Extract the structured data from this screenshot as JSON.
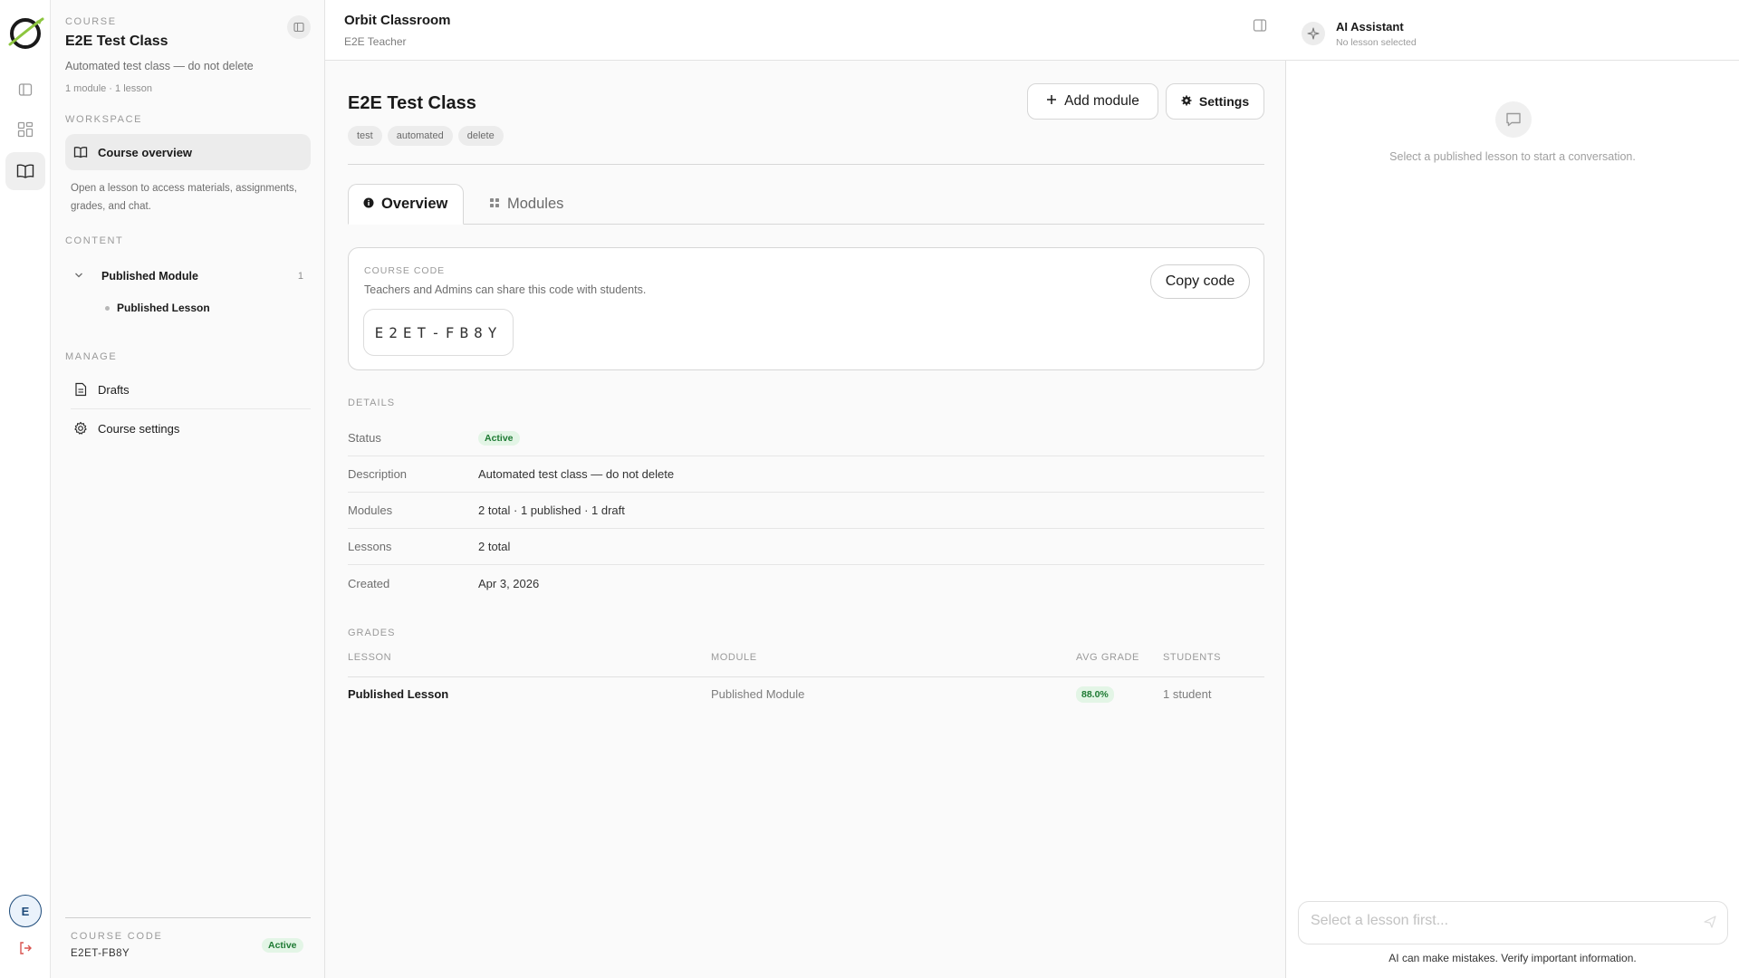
{
  "sidebar": {
    "course_label": "COURSE",
    "course_title": "E2E Test Class",
    "course_description": "Automated test class — do not delete",
    "course_meta": "1 module · 1 lesson",
    "workspace_label": "WORKSPACE",
    "course_overview": "Course overview",
    "help_text": "Open a lesson to access materials, assignments, grades, and chat.",
    "content_label": "CONTENT",
    "module_name": "Published Module",
    "module_count": "1",
    "lesson_name": "Published Lesson",
    "manage_label": "MANAGE",
    "drafts": "Drafts",
    "course_settings": "Course settings",
    "footer_label": "COURSE CODE",
    "footer_code": "E2ET-FB8Y",
    "footer_status": "Active"
  },
  "rail": {
    "avatar_initial": "E"
  },
  "topbar": {
    "app_name": "Orbit Classroom",
    "role": "E2E Teacher"
  },
  "page": {
    "title": "E2E Test Class",
    "tags": [
      "test",
      "automated",
      "delete"
    ],
    "add_module": "Add module",
    "settings": "Settings",
    "tabs": [
      "Overview",
      "Modules"
    ]
  },
  "code_card": {
    "label": "COURSE CODE",
    "subtitle": "Teachers and Admins can share this code with students.",
    "code": "E2ET-FB8Y",
    "copy_button": "Copy code"
  },
  "details": {
    "label": "DETAILS",
    "rows": [
      {
        "key": "Status",
        "value": "Active"
      },
      {
        "key": "Description",
        "value": "Automated test class — do not delete"
      },
      {
        "key": "Modules",
        "value": "2 total · 1 published · 1 draft"
      },
      {
        "key": "Lessons",
        "value": "2 total"
      },
      {
        "key": "Created",
        "value": "Apr 3, 2026"
      }
    ]
  },
  "grades": {
    "label": "GRADES",
    "columns": [
      "LESSON",
      "MODULE",
      "AVG GRADE",
      "STUDENTS"
    ],
    "rows": [
      {
        "lesson": "Published Lesson",
        "module": "Published Module",
        "avg_grade": "88.0%",
        "students": "1 student"
      }
    ]
  },
  "ai_panel": {
    "title": "AI Assistant",
    "subtitle": "No lesson selected",
    "empty_text": "Select a published lesson to start a conversation.",
    "input_placeholder": "Select a lesson first...",
    "disclaimer": "AI can make mistakes. Verify important information."
  },
  "colors": {
    "active_green_bg": "#e3f5e6",
    "active_green_text": "#1e7a33",
    "avatar_blue": "#1e4b7a",
    "logout_red": "#d9534f"
  }
}
